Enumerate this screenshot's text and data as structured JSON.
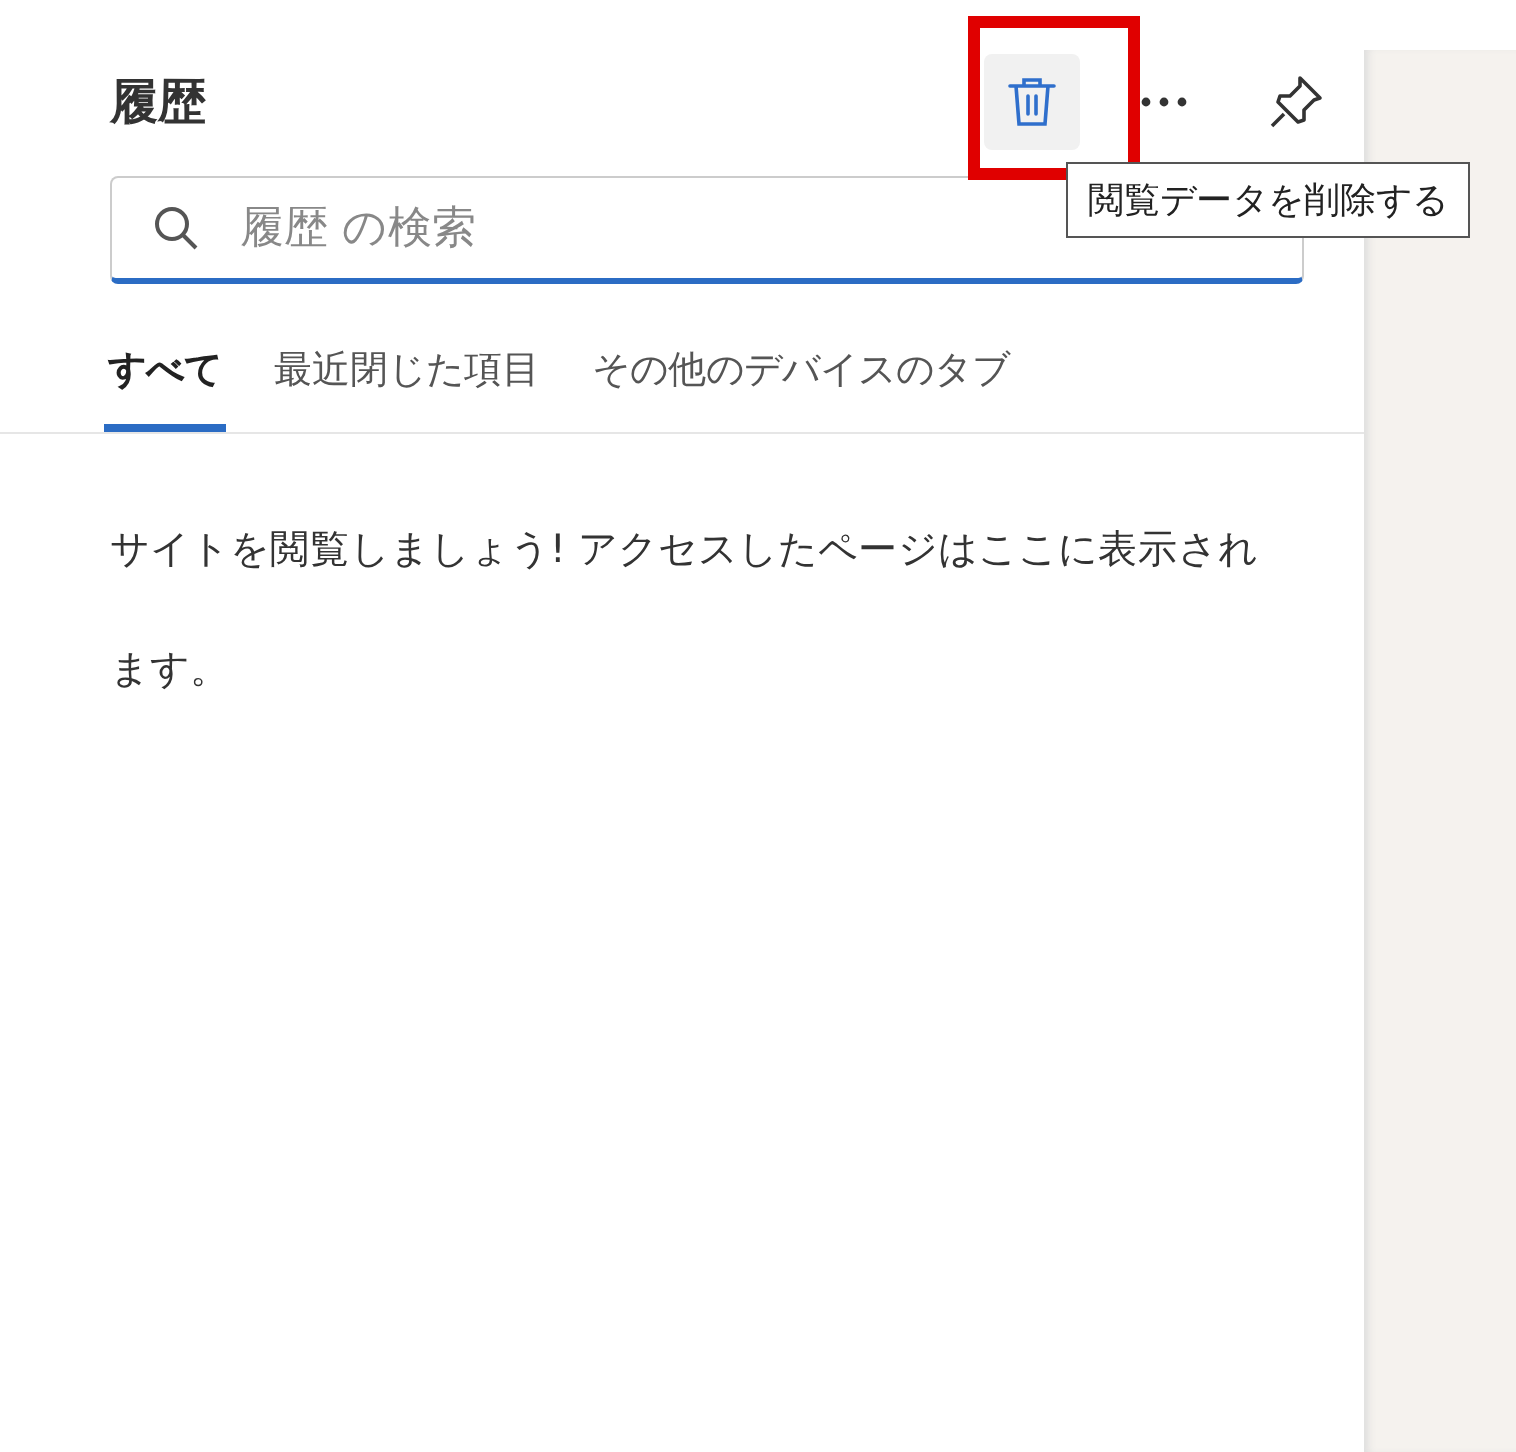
{
  "panel": {
    "title": "履歴",
    "toolbar": [
      {
        "kind": "delete",
        "hovered": true
      },
      {
        "kind": "more"
      },
      {
        "kind": "pin"
      }
    ],
    "tooltip": "閲覧データを削除する",
    "annotation": {
      "kind": "highlight-box"
    },
    "search": {
      "placeholder": "履歴 の検索"
    },
    "tabs": [
      {
        "label": "すべて",
        "selected": true
      },
      {
        "label": "最近閉じた項目",
        "selected": false
      },
      {
        "label": "その他のデバイスのタブ",
        "selected": false
      }
    ],
    "empty_message": "サイトを閲覧しましょう! アクセスしたページはここに表示されます。"
  }
}
